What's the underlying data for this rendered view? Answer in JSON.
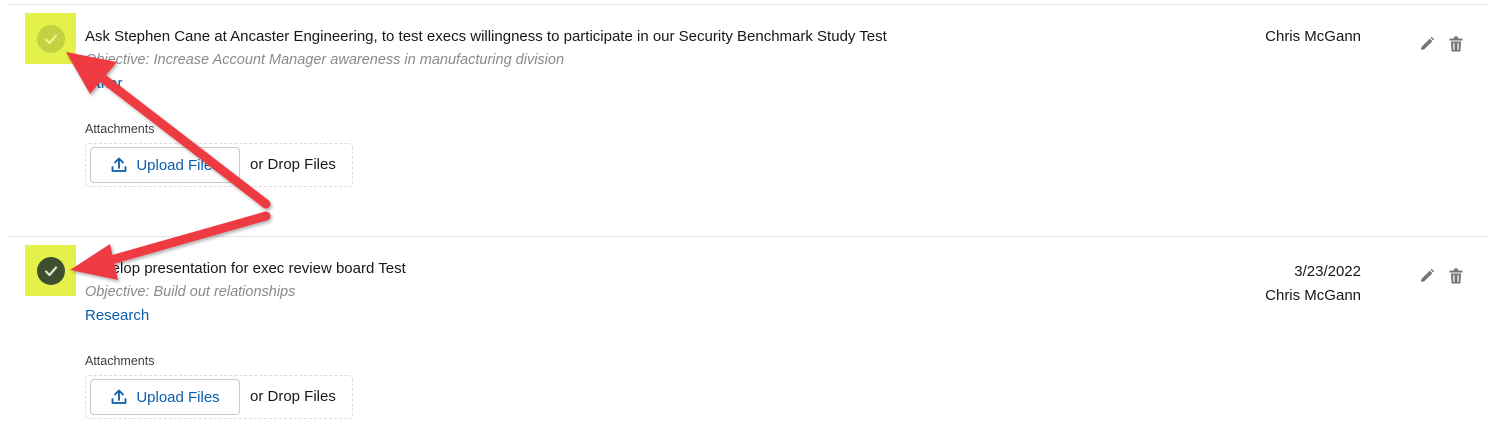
{
  "tasks": [
    {
      "subject": "Ask Stephen Cane at Ancaster Engineering, to test execs willingness to participate in our Security Benchmark Study Test",
      "objective": "Objective: Increase Account Manager awareness in manufacturing division",
      "type": "Other",
      "date": "",
      "assignee": "Chris McGann",
      "status": "incomplete",
      "attachments_label": "Attachments",
      "upload_label": "Upload Files",
      "drop_label": "or Drop Files"
    },
    {
      "subject": "Develop presentation for exec review board Test",
      "objective": "Objective: Build out relationships",
      "type": "Research",
      "date": "3/23/2022",
      "assignee": "Chris McGann",
      "status": "complete",
      "attachments_label": "Attachments",
      "upload_label": "Upload Files",
      "drop_label": "or Drop Files"
    }
  ],
  "icons": {
    "check": "check-icon",
    "upload": "upload-icon",
    "edit": "pencil-icon",
    "delete": "trash-icon"
  },
  "colors": {
    "highlight": "#e3f14a",
    "check_incomplete": "#c3d243",
    "check_complete": "#3e4e30",
    "link": "#0b5cab",
    "annotation_arrow": "#ee3b43"
  }
}
